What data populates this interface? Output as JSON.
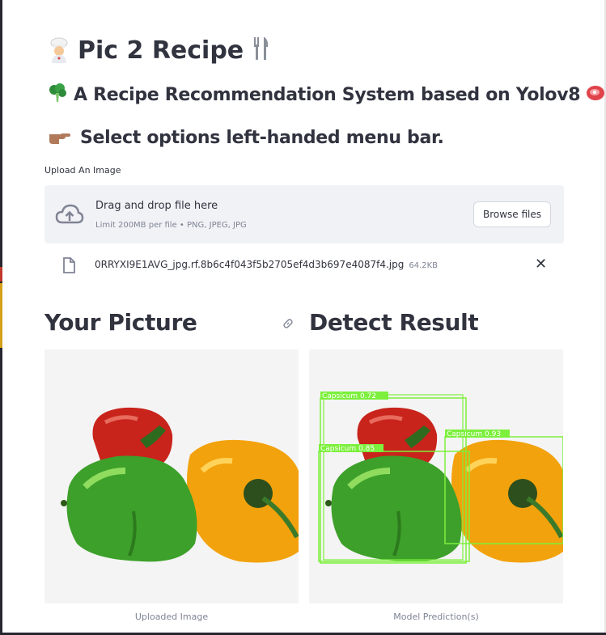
{
  "header": {
    "title": "Pic 2 Recipe",
    "subtitle": "A Recipe Recommendation System based on Yolov8",
    "instruction": "Select options left-handed menu bar."
  },
  "uploader": {
    "label": "Upload An Image",
    "drop_text": "Drag and drop file here",
    "limit_text": "Limit 200MB per file • PNG, JPEG, JPG",
    "browse_label": "Browse files"
  },
  "file": {
    "name": "0RRYXI9E1AVG_jpg.rf.8b6c4f043f5b2705ef4d3b697e4087f4.jpg",
    "size": "64.2KB"
  },
  "columns": {
    "left_title": "Your Picture",
    "right_title": "Detect Result",
    "left_caption": "Uploaded Image",
    "right_caption": "Model Prediction(s)"
  },
  "detections": [
    {
      "label": "Capsicum",
      "confidence": "0.72"
    },
    {
      "label": "Capsicum",
      "confidence": "0.93"
    },
    {
      "label": "Capsicum",
      "confidence": "0.85"
    }
  ],
  "colors": {
    "detection_box": "#7cf03c",
    "text": "#31333f",
    "muted": "#808495",
    "dropzone_bg": "#f0f2f6"
  },
  "icons": [
    "chef-icon",
    "fork-knife-icon",
    "broccoli-icon",
    "meat-icon",
    "pointing-hand-icon",
    "cloud-upload-icon",
    "file-icon",
    "close-icon",
    "link-icon"
  ]
}
